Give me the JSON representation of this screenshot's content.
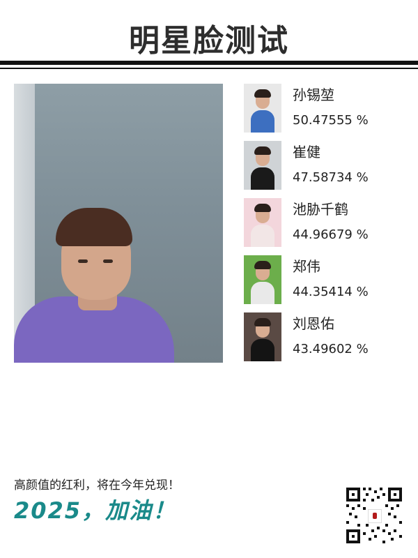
{
  "header": {
    "title": "明星脸测试"
  },
  "photo": {
    "icon": "portrait-photo"
  },
  "results": [
    {
      "name": "孙锡堃",
      "score": "50.47555 %",
      "thumb_bg": "#e8e8e8",
      "thumb_body": "#3d6fc0"
    },
    {
      "name": "崔健",
      "score": "47.58734 %",
      "thumb_bg": "#cfd3d6",
      "thumb_body": "#1a1a1a"
    },
    {
      "name": "池胁千鹤",
      "score": "44.96679 %",
      "thumb_bg": "#f3d6dc",
      "thumb_body": "#f2e6e6"
    },
    {
      "name": "郑伟",
      "score": "44.35414 %",
      "thumb_bg": "#6cae4b",
      "thumb_body": "#e9e9e9"
    },
    {
      "name": "刘恩佑",
      "score": "43.49602 %",
      "thumb_bg": "#5a4a44",
      "thumb_body": "#141414"
    }
  ],
  "footer": {
    "slogan": "高颜值的红利，将在今年兑现！",
    "cheer": "2025，加油！",
    "cheer_color": "#1a8a8a",
    "qr_icon": "qr-code-icon"
  }
}
